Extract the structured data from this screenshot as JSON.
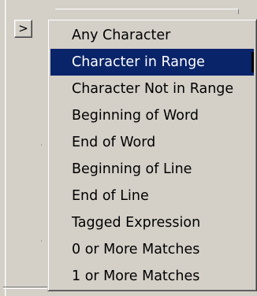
{
  "expand_button": {
    "glyph": ">",
    "icon": "chevron-right-icon"
  },
  "menu": {
    "selected_index": 1,
    "selection_color": "#0a246a",
    "items": [
      {
        "label": "Any Character"
      },
      {
        "label": "Character in Range"
      },
      {
        "label": "Character Not in Range"
      },
      {
        "label": "Beginning of Word"
      },
      {
        "label": "End of Word"
      },
      {
        "label": "Beginning of Line"
      },
      {
        "label": "End of Line"
      },
      {
        "label": "Tagged Expression"
      },
      {
        "label": "0 or More Matches"
      },
      {
        "label": "1 or More Matches"
      }
    ]
  }
}
